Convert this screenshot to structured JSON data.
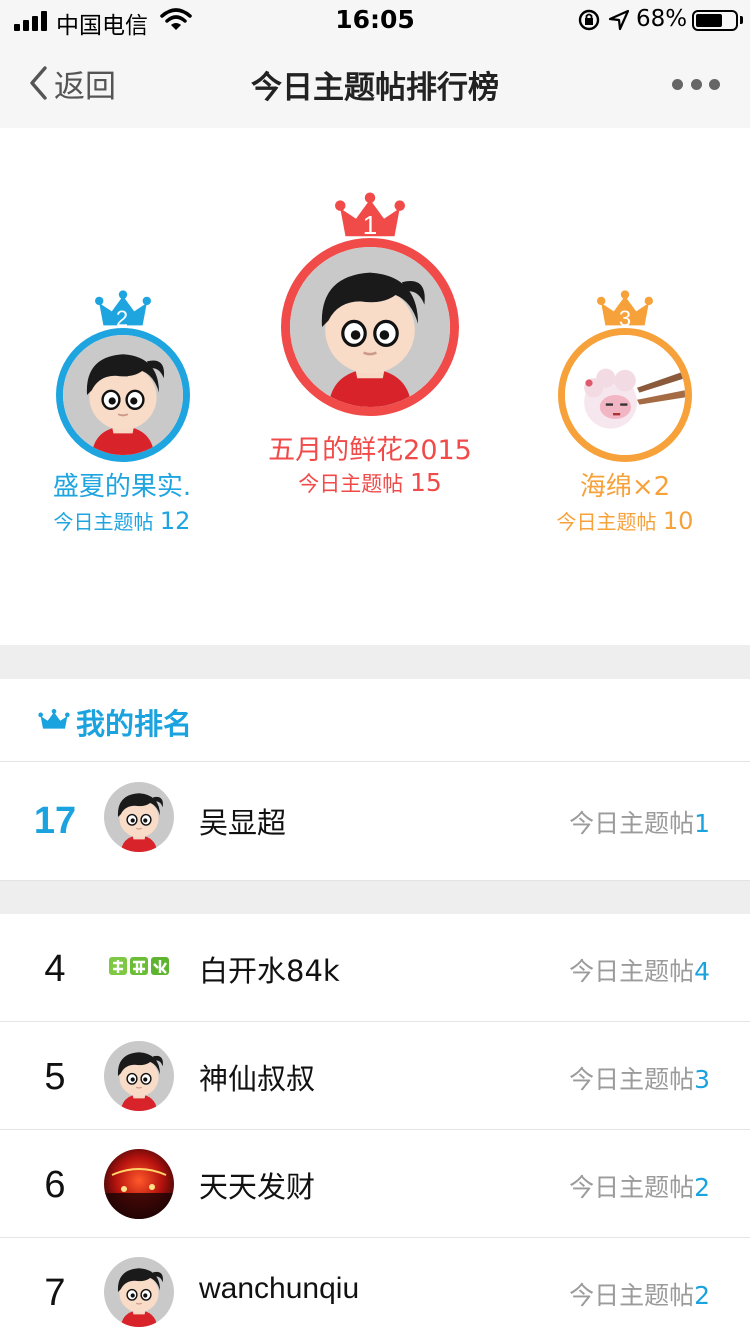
{
  "status_bar": {
    "carrier": "中国电信",
    "time": "16:05",
    "battery": "68%",
    "battery_level": 0.68
  },
  "nav": {
    "back_label": "返回",
    "title": "今日主题帖排行榜"
  },
  "podium": [
    {
      "rank": "1",
      "name": "五月的鲜花2015",
      "count_label": "今日主题帖",
      "count": "15",
      "color": "#f04a49"
    },
    {
      "rank": "2",
      "name": "盛夏的果实.",
      "count_label": "今日主题帖",
      "count": "12",
      "color": "#1ea5e0"
    },
    {
      "rank": "3",
      "name": "海绵×2",
      "count_label": "今日主题帖",
      "count": "10",
      "color": "#f7a13a"
    }
  ],
  "my_rank": {
    "title": "我的排名",
    "rank": "17",
    "name": "吴显超",
    "count_label": "今日主题帖",
    "count": "1"
  },
  "list": [
    {
      "rank": "4",
      "name": "白开水84k",
      "count_label": "今日主题帖",
      "count": "4",
      "avatar": "logo-bkaishui"
    },
    {
      "rank": "5",
      "name": "神仙叔叔",
      "count_label": "今日主题帖",
      "count": "3",
      "avatar": "cartoon-boy"
    },
    {
      "rank": "6",
      "name": "天天发财",
      "count_label": "今日主题帖",
      "count": "2",
      "avatar": "red-lights"
    },
    {
      "rank": "7",
      "name": "wanchunqiu",
      "count_label": "今日主题帖",
      "count": "2",
      "avatar": "cartoon-boy"
    }
  ],
  "colors": {
    "accent": "#1aa3de",
    "gold": "#f04a49",
    "silver": "#1ea5e0",
    "bronze": "#f7a13a"
  }
}
